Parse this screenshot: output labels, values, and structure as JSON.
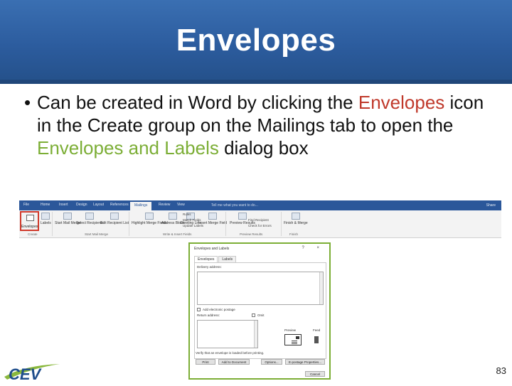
{
  "slide": {
    "title": "Envelopes",
    "page_number": "83",
    "bullet": {
      "part1": "Can be created in Word by clicking the ",
      "highlight1": "Envelopes",
      "part2": " icon in the Create group on the Mailings tab to open the ",
      "highlight2": "Envelopes and Labels",
      "part3": " dialog box"
    }
  },
  "colors": {
    "banner": "#2c5c9e",
    "highlight_red": "#c0392b",
    "highlight_green": "#7cae36",
    "ribbon_blue": "#2b579a"
  },
  "ribbon": {
    "tabs": [
      "File",
      "Home",
      "Insert",
      "Design",
      "Layout",
      "References",
      "Mailings",
      "Review",
      "View"
    ],
    "active_tab": "Mailings",
    "tell_me": "Tell me what you want to do...",
    "share": "Share",
    "buttons": {
      "envelopes": "Envelopes",
      "labels": "Labels",
      "start_mail_merge": "Start Mail Merge",
      "select_recipients": "Select Recipients",
      "edit_recipient_list": "Edit Recipient List",
      "highlight_merge_fields": "Highlight Merge Fields",
      "address_block": "Address Block",
      "greeting_line": "Greeting Line",
      "insert_merge_field": "Insert Merge Field",
      "preview_results": "Preview Results",
      "finish_merge": "Finish & Merge"
    },
    "small": {
      "rules": "Rules",
      "match_fields": "Match Fields",
      "update_labels": "Update Labels",
      "find_recipient": "Find Recipient",
      "check_errors": "Check for Errors"
    },
    "groups": {
      "create": "Create",
      "start": "Start Mail Merge",
      "write": "Write & Insert Fields",
      "preview": "Preview Results",
      "finish": "Finish"
    }
  },
  "dialog": {
    "title": "Envelopes and Labels",
    "controls": "? ×",
    "tabs": [
      "Envelopes",
      "Labels"
    ],
    "delivery_address": "Delivery address:",
    "add_postage": "Add electronic postage",
    "return_address": "Return address:",
    "omit": "Omit",
    "preview": "Preview",
    "feed": "Feed",
    "note": "Verify that an envelope is loaded before printing.",
    "buttons": {
      "print": "Print",
      "add_to_document": "Add to Document",
      "options": "Options...",
      "e_postage": "E-postage Properties...",
      "cancel": "Cancel"
    }
  },
  "logo": {
    "text": "CEV"
  }
}
